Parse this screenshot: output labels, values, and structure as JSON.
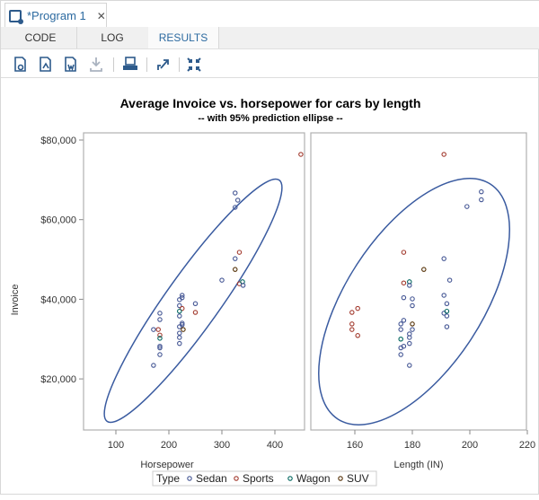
{
  "window": {
    "tab_title": "*Program 1",
    "close_label": "✕",
    "subtabs": [
      "CODE",
      "LOG",
      "RESULTS"
    ],
    "active_subtab": "RESULTS"
  },
  "toolbar": {
    "icons": [
      {
        "name": "download-html-icon",
        "glyph": "🗋",
        "enabled": true
      },
      {
        "name": "download-pdf-icon",
        "glyph": "🗋",
        "enabled": true
      },
      {
        "name": "download-word-icon",
        "glyph": "🗋",
        "enabled": true
      },
      {
        "name": "download-icon",
        "glyph": "⤓",
        "enabled": false
      },
      {
        "name": "print-icon",
        "glyph": "🖶",
        "enabled": true
      },
      {
        "name": "open-new-window-icon",
        "glyph": "↗",
        "enabled": true
      },
      {
        "name": "collapse-icon",
        "glyph": "✕",
        "enabled": true
      }
    ]
  },
  "colors": {
    "Sedan": "#445694",
    "Sports": "#A23A2E",
    "Wagon": "#01665E",
    "SUV": "#543005",
    "ellipse": "#3A5BA0"
  },
  "chart_data": {
    "type": "scatter",
    "title": "Average Invoice vs. horsepower for cars by length",
    "subtitle": "-- with 95% prediction ellipse --",
    "ylabel": "Invoice",
    "yticks": [
      "$20,000",
      "$40,000",
      "$60,000",
      "$80,000"
    ],
    "ytick_values": [
      20000,
      40000,
      60000,
      80000
    ],
    "legend": {
      "title": "Type",
      "entries": [
        "Sedan",
        "Sports",
        "Wagon",
        "SUV"
      ],
      "placement": "bottom"
    },
    "panels": [
      {
        "xlabel": "Horsepower",
        "xticks": [
          "100",
          "200",
          "300",
          "400"
        ],
        "xtick_values": [
          100,
          200,
          300,
          400
        ],
        "points": [
          {
            "x": 449,
            "y": 76400,
            "type": "Sports"
          },
          {
            "x": 325,
            "y": 66700,
            "type": "Sedan"
          },
          {
            "x": 330,
            "y": 64900,
            "type": "Sedan"
          },
          {
            "x": 325,
            "y": 63100,
            "type": "Sedan"
          },
          {
            "x": 333,
            "y": 51800,
            "type": "Sports"
          },
          {
            "x": 325,
            "y": 50200,
            "type": "Sedan"
          },
          {
            "x": 325,
            "y": 47500,
            "type": "SUV"
          },
          {
            "x": 300,
            "y": 44800,
            "type": "Sedan"
          },
          {
            "x": 333,
            "y": 43900,
            "type": "Sports"
          },
          {
            "x": 339,
            "y": 44400,
            "type": "Wagon"
          },
          {
            "x": 340,
            "y": 43500,
            "type": "Sedan"
          },
          {
            "x": 225,
            "y": 41000,
            "type": "Sedan"
          },
          {
            "x": 225,
            "y": 40400,
            "type": "Sedan"
          },
          {
            "x": 220,
            "y": 39900,
            "type": "Sedan"
          },
          {
            "x": 250,
            "y": 38900,
            "type": "Sedan"
          },
          {
            "x": 220,
            "y": 38400,
            "type": "Sedan"
          },
          {
            "x": 225,
            "y": 37700,
            "type": "Sports"
          },
          {
            "x": 220,
            "y": 37000,
            "type": "Wagon"
          },
          {
            "x": 250,
            "y": 36700,
            "type": "Sports"
          },
          {
            "x": 220,
            "y": 35800,
            "type": "Sedan"
          },
          {
            "x": 183,
            "y": 36500,
            "type": "Sedan"
          },
          {
            "x": 183,
            "y": 34900,
            "type": "Sedan"
          },
          {
            "x": 171,
            "y": 32400,
            "type": "Sedan"
          },
          {
            "x": 180,
            "y": 32400,
            "type": "Sports"
          },
          {
            "x": 183,
            "y": 31000,
            "type": "Sports"
          },
          {
            "x": 183,
            "y": 30200,
            "type": "Wagon"
          },
          {
            "x": 183,
            "y": 28200,
            "type": "Sedan"
          },
          {
            "x": 183,
            "y": 27800,
            "type": "Sedan"
          },
          {
            "x": 183,
            "y": 26100,
            "type": "Sedan"
          },
          {
            "x": 171,
            "y": 23400,
            "type": "Sedan"
          },
          {
            "x": 225,
            "y": 34000,
            "type": "Sedan"
          },
          {
            "x": 225,
            "y": 33600,
            "type": "Sedan"
          },
          {
            "x": 220,
            "y": 33100,
            "type": "Sedan"
          },
          {
            "x": 227,
            "y": 32400,
            "type": "SUV"
          },
          {
            "x": 220,
            "y": 31500,
            "type": "Sedan"
          },
          {
            "x": 220,
            "y": 30400,
            "type": "Sedan"
          },
          {
            "x": 220,
            "y": 28900,
            "type": "Sedan"
          }
        ]
      },
      {
        "xlabel": "Length (IN)",
        "xticks": [
          "160",
          "180",
          "200",
          "220"
        ],
        "xtick_values": [
          160,
          180,
          200,
          220
        ],
        "points": [
          {
            "x": 191,
            "y": 76400,
            "type": "Sports"
          },
          {
            "x": 204,
            "y": 67000,
            "type": "Sedan"
          },
          {
            "x": 204,
            "y": 65000,
            "type": "Sedan"
          },
          {
            "x": 199,
            "y": 63300,
            "type": "Sedan"
          },
          {
            "x": 177,
            "y": 51800,
            "type": "Sports"
          },
          {
            "x": 191,
            "y": 50200,
            "type": "Sedan"
          },
          {
            "x": 184,
            "y": 47500,
            "type": "SUV"
          },
          {
            "x": 193,
            "y": 44800,
            "type": "Sedan"
          },
          {
            "x": 177,
            "y": 44100,
            "type": "Sports"
          },
          {
            "x": 179,
            "y": 44400,
            "type": "Wagon"
          },
          {
            "x": 179,
            "y": 43500,
            "type": "Sedan"
          },
          {
            "x": 177,
            "y": 40400,
            "type": "Sedan"
          },
          {
            "x": 180,
            "y": 40100,
            "type": "Sedan"
          },
          {
            "x": 180,
            "y": 38400,
            "type": "Sedan"
          },
          {
            "x": 191,
            "y": 41000,
            "type": "Sedan"
          },
          {
            "x": 192,
            "y": 38900,
            "type": "Sedan"
          },
          {
            "x": 191,
            "y": 36500,
            "type": "Sedan"
          },
          {
            "x": 192,
            "y": 37000,
            "type": "Wagon"
          },
          {
            "x": 192,
            "y": 35800,
            "type": "Sedan"
          },
          {
            "x": 192,
            "y": 33100,
            "type": "Sedan"
          },
          {
            "x": 159,
            "y": 36700,
            "type": "Sports"
          },
          {
            "x": 161,
            "y": 37700,
            "type": "Sports"
          },
          {
            "x": 159,
            "y": 33800,
            "type": "Sports"
          },
          {
            "x": 159,
            "y": 32400,
            "type": "Sports"
          },
          {
            "x": 161,
            "y": 30900,
            "type": "Sports"
          },
          {
            "x": 177,
            "y": 34700,
            "type": "Sedan"
          },
          {
            "x": 176,
            "y": 33800,
            "type": "Sedan"
          },
          {
            "x": 180,
            "y": 33800,
            "type": "SUV"
          },
          {
            "x": 176,
            "y": 32400,
            "type": "Sedan"
          },
          {
            "x": 180,
            "y": 32400,
            "type": "Sedan"
          },
          {
            "x": 179,
            "y": 31300,
            "type": "Sedan"
          },
          {
            "x": 179,
            "y": 30400,
            "type": "Sedan"
          },
          {
            "x": 176,
            "y": 30000,
            "type": "Wagon"
          },
          {
            "x": 179,
            "y": 28900,
            "type": "Sedan"
          },
          {
            "x": 177,
            "y": 28200,
            "type": "Sedan"
          },
          {
            "x": 176,
            "y": 27800,
            "type": "Sedan"
          },
          {
            "x": 176,
            "y": 26100,
            "type": "Sedan"
          },
          {
            "x": 179,
            "y": 23400,
            "type": "Sedan"
          }
        ]
      }
    ]
  }
}
